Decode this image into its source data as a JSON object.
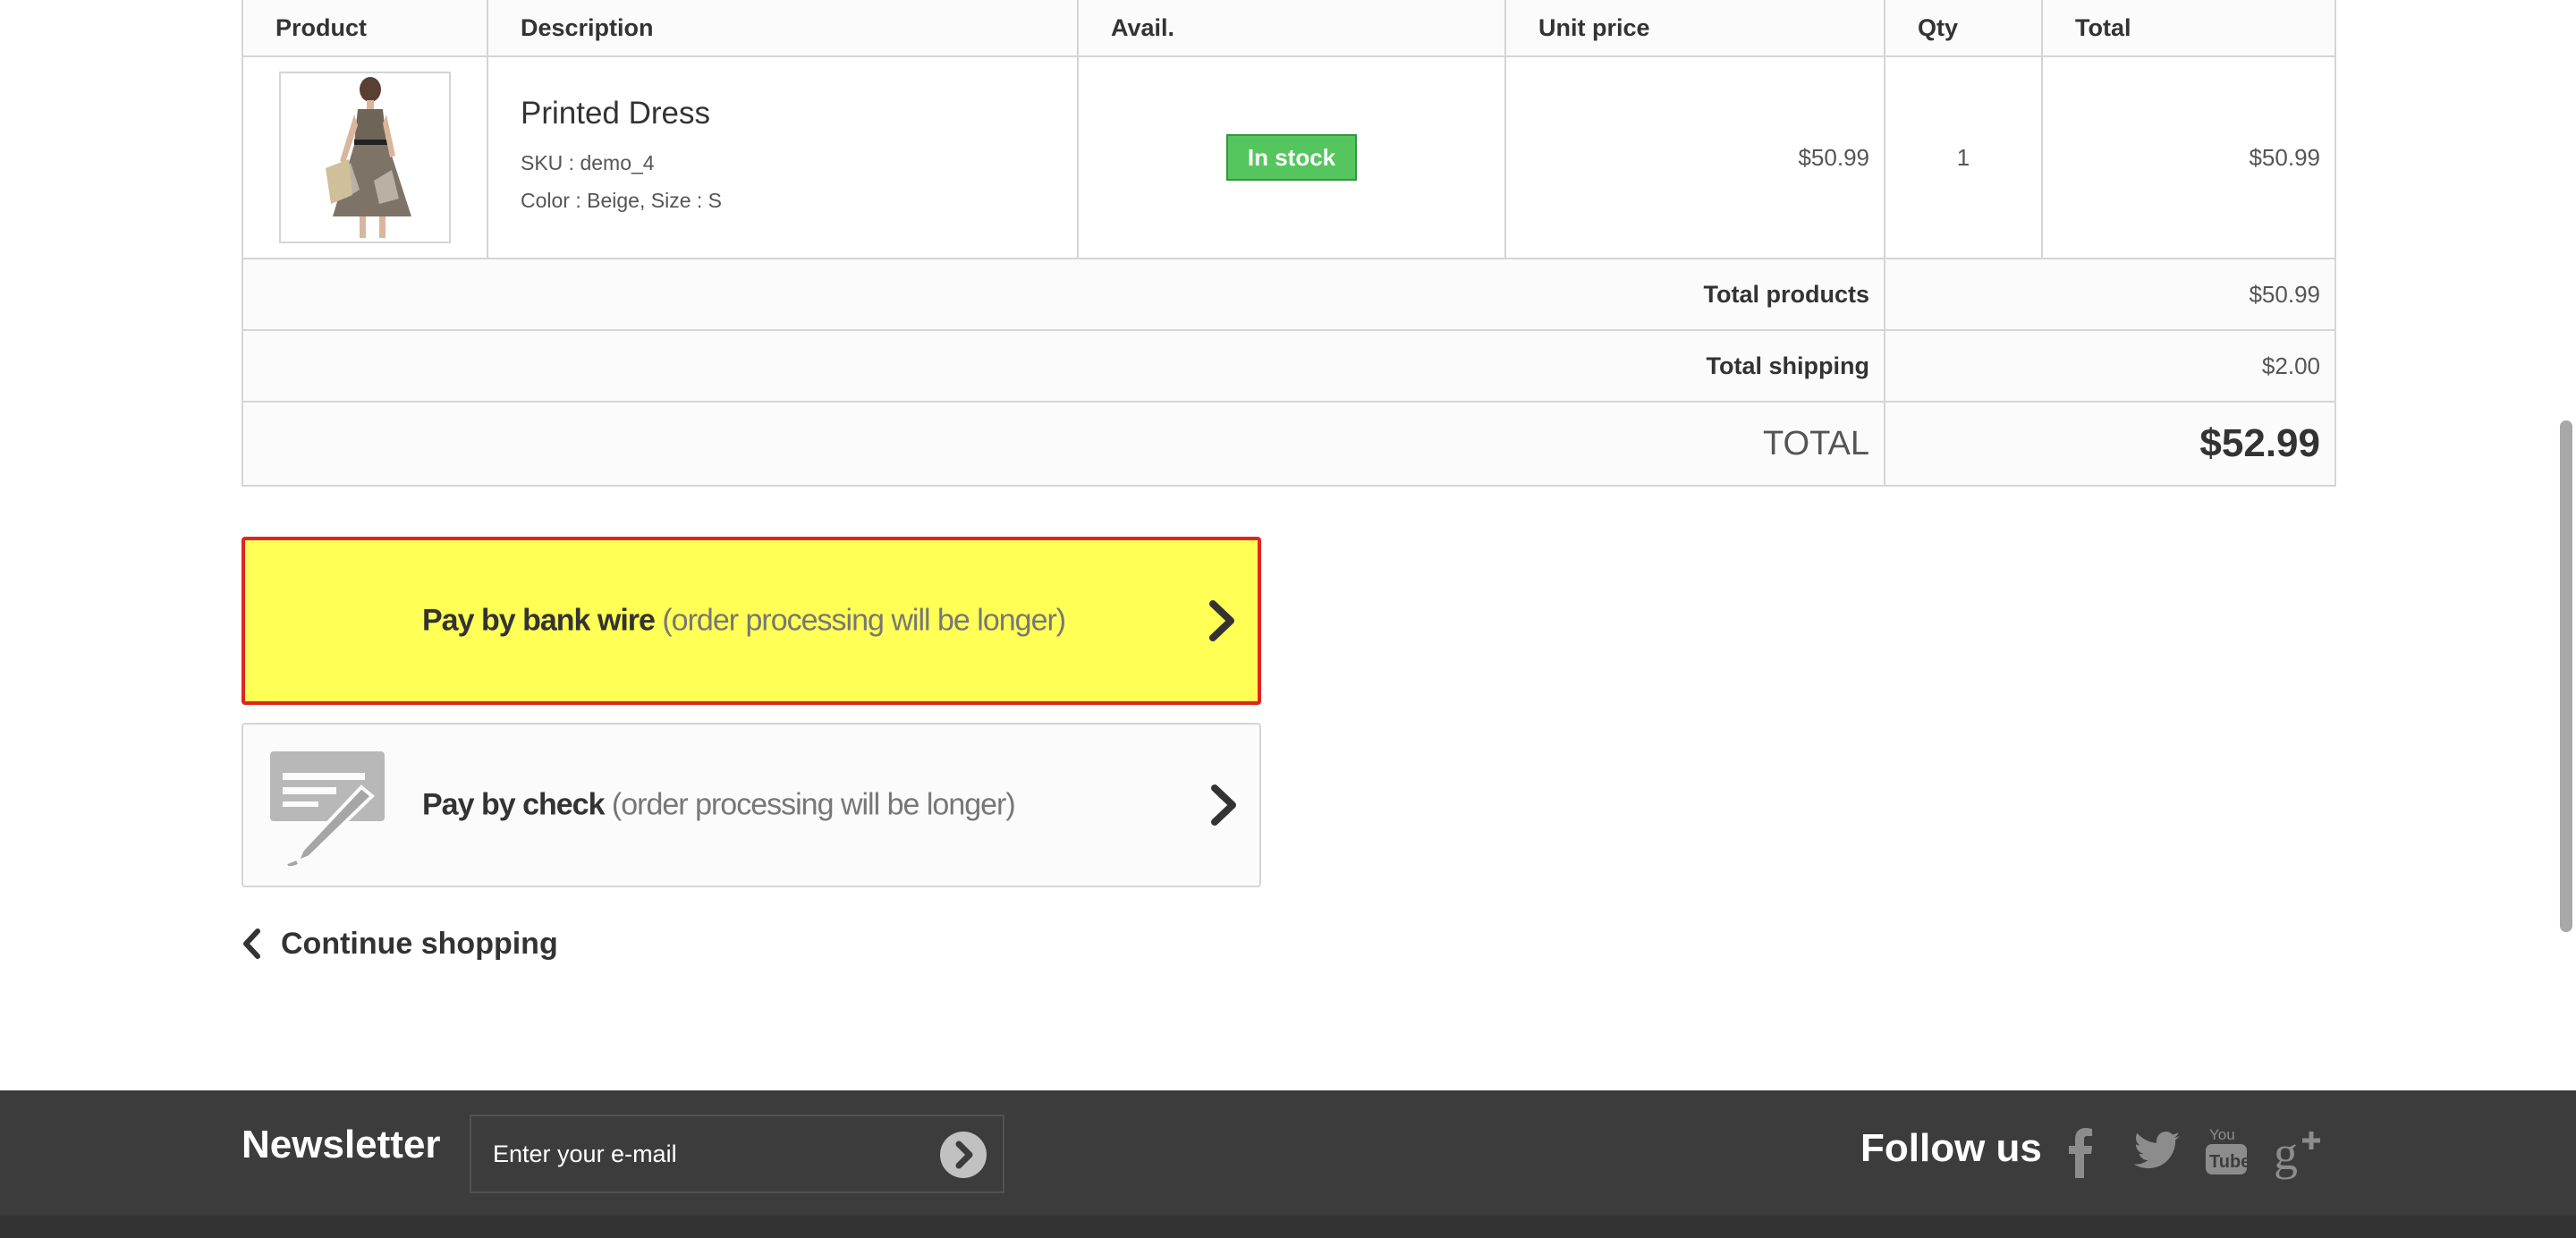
{
  "table": {
    "headers": {
      "product": "Product",
      "description": "Description",
      "avail": "Avail.",
      "unit_price": "Unit price",
      "qty": "Qty",
      "total": "Total"
    },
    "item": {
      "name": "Printed Dress",
      "sku": "SKU : demo_4",
      "attributes": "Color : Beige, Size : S",
      "availability": "In stock",
      "unit_price": "$50.99",
      "qty": "1",
      "total": "$50.99"
    },
    "summary": {
      "total_products_label": "Total products",
      "total_products_value": "$50.99",
      "total_shipping_label": "Total shipping",
      "total_shipping_value": "$2.00",
      "total_label": "TOTAL",
      "total_value": "$52.99"
    }
  },
  "payment": {
    "bank_wire": {
      "label": "Pay by bank wire",
      "note": " (order processing will be longer)"
    },
    "check": {
      "label": "Pay by check",
      "note": " (order processing will be longer)"
    }
  },
  "continue_shopping": "Continue shopping",
  "footer": {
    "newsletter_title": "Newsletter",
    "email_placeholder": "Enter your e-mail",
    "follow_title": "Follow us",
    "social_icons": [
      "facebook-icon",
      "twitter-icon",
      "youtube-icon",
      "google-plus-icon"
    ]
  },
  "colors": {
    "stock_badge": "#55c65e",
    "highlight_background": "#ffff55",
    "highlight_border": "#e0251f",
    "footer_background": "#3c3c3c"
  }
}
